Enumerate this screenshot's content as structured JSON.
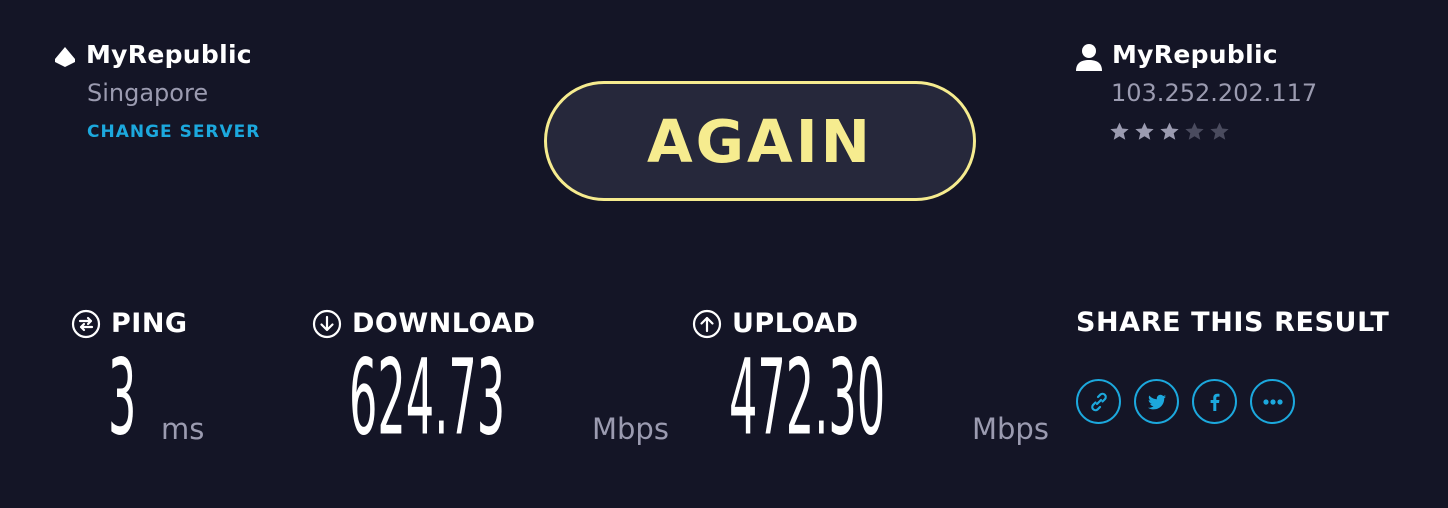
{
  "server": {
    "name": "MyRepublic",
    "city": "Singapore",
    "change_label": "CHANGE SERVER",
    "icon": "server-location-icon"
  },
  "action": {
    "again_label": "AGAIN"
  },
  "isp": {
    "name": "MyRepublic",
    "ip": "103.252.202.117",
    "icon": "user-icon",
    "rating": 3,
    "rating_max": 5
  },
  "metrics": {
    "ping": {
      "label": "PING",
      "value": "3",
      "unit": "ms",
      "icon": "ping-icon"
    },
    "download": {
      "label": "DOWNLOAD",
      "value": "624.73",
      "unit": "Mbps",
      "icon": "download-icon"
    },
    "upload": {
      "label": "UPLOAD",
      "value": "472.30",
      "unit": "Mbps",
      "icon": "upload-icon"
    }
  },
  "share": {
    "title": "SHARE THIS RESULT",
    "buttons": [
      "link-icon",
      "twitter-icon",
      "facebook-icon",
      "more-icon"
    ]
  },
  "colors": {
    "background": "#141526",
    "accent_yellow": "#f6ec8f",
    "accent_blue": "#1ca8dd",
    "muted_text": "#9b9bb0",
    "star_active": "#9b9bb0",
    "star_inactive": "#4a4b5e"
  }
}
